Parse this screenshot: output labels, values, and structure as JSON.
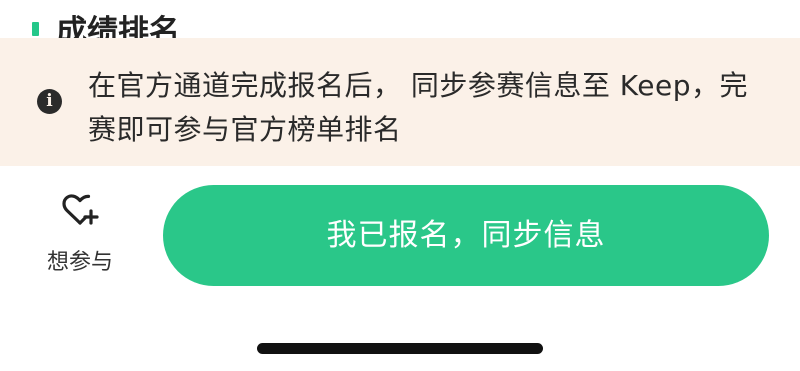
{
  "section": {
    "title": "成绩排名",
    "accent_color": "#24c789"
  },
  "notice": {
    "icon": "info-icon",
    "text": "在官方通道完成报名后， 同步参赛信息至 Keep，完赛即可参与官方榜单排名",
    "background_color": "#fbf1e8"
  },
  "actions": {
    "follow": {
      "icon": "heart-plus-icon",
      "label": "想参与"
    },
    "sync": {
      "label": "我已报名，同步信息",
      "color": "#2ac789"
    }
  }
}
